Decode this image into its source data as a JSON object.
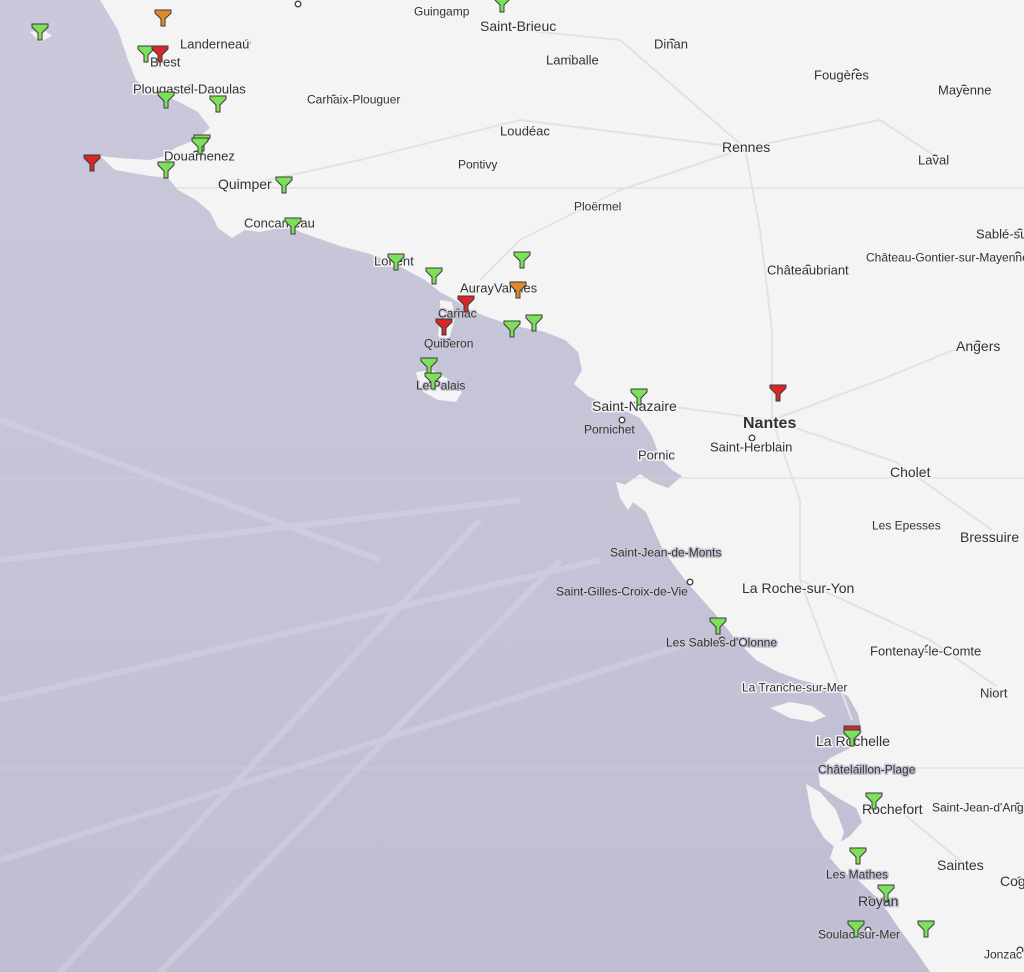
{
  "colors": {
    "land": "#f4f4f5",
    "sea": "#c5c3d6",
    "road": "#ffffff",
    "marker_green": "#7ee05a",
    "marker_red": "#d8262a",
    "marker_orange": "#e08a2a"
  },
  "cities": [
    {
      "name": "Guingamp"
    },
    {
      "name": "Saint-Brieuc"
    },
    {
      "name": "Landerneau"
    },
    {
      "name": "Brest"
    },
    {
      "name": "Lamballe"
    },
    {
      "name": "Dinan"
    },
    {
      "name": "Plougastel-Daoulas"
    },
    {
      "name": "Carhaix-Plouguer"
    },
    {
      "name": "Fougères"
    },
    {
      "name": "Mayenne"
    },
    {
      "name": "Loudéac"
    },
    {
      "name": "Rennes"
    },
    {
      "name": "Douarnenez"
    },
    {
      "name": "Pontivy"
    },
    {
      "name": "Laval"
    },
    {
      "name": "Quimper"
    },
    {
      "name": "Ploërmel"
    },
    {
      "name": "Concarneau"
    },
    {
      "name": "Sablé-sur-Sarthe"
    },
    {
      "name": "Château-Gontier-sur-Mayenne"
    },
    {
      "name": "Lorient"
    },
    {
      "name": "Châteaubriant"
    },
    {
      "name": "Auray"
    },
    {
      "name": "Vannes"
    },
    {
      "name": "Carnac"
    },
    {
      "name": "Quiberon"
    },
    {
      "name": "Angers"
    },
    {
      "name": "Le Palais"
    },
    {
      "name": "Saint-Nazaire"
    },
    {
      "name": "Nantes"
    },
    {
      "name": "Pornichet"
    },
    {
      "name": "Saint-Herblain"
    },
    {
      "name": "Pornic"
    },
    {
      "name": "Cholet"
    },
    {
      "name": "Les Epesses"
    },
    {
      "name": "Bressuire"
    },
    {
      "name": "Saint-Jean-de-Monts"
    },
    {
      "name": "Saint-Gilles-Croix-de-Vie"
    },
    {
      "name": "La Roche-sur-Yon"
    },
    {
      "name": "Les Sables-d'Olonne"
    },
    {
      "name": "Fontenay-le-Comte"
    },
    {
      "name": "La Tranche-sur-Mer"
    },
    {
      "name": "Niort"
    },
    {
      "name": "La Rochelle"
    },
    {
      "name": "Châtelaillon-Plage"
    },
    {
      "name": "Rochefort"
    },
    {
      "name": "Saint-Jean-d'Angély"
    },
    {
      "name": "Saintes"
    },
    {
      "name": "Les Mathes"
    },
    {
      "name": "Royan"
    },
    {
      "name": "Cognac"
    },
    {
      "name": "Soulac-sur-Mer"
    },
    {
      "name": "Jonzac"
    }
  ],
  "markers": [
    {
      "status": "green"
    },
    {
      "status": "orange"
    },
    {
      "status": "green"
    },
    {
      "status": "red"
    },
    {
      "status": "green"
    },
    {
      "status": "green"
    },
    {
      "status": "green"
    },
    {
      "status": "red"
    },
    {
      "status": "green"
    },
    {
      "status": "green"
    },
    {
      "status": "green"
    },
    {
      "status": "green"
    },
    {
      "status": "green"
    },
    {
      "status": "green"
    },
    {
      "status": "orange"
    },
    {
      "status": "red"
    },
    {
      "status": "red"
    },
    {
      "status": "green"
    },
    {
      "status": "green"
    },
    {
      "status": "green"
    },
    {
      "status": "green"
    },
    {
      "status": "green"
    },
    {
      "status": "red"
    },
    {
      "status": "green"
    },
    {
      "status": "red"
    },
    {
      "status": "green"
    },
    {
      "status": "green"
    },
    {
      "status": "green"
    },
    {
      "status": "green"
    },
    {
      "status": "green"
    },
    {
      "status": "green"
    },
    {
      "status": "green"
    },
    {
      "status": "green"
    }
  ]
}
